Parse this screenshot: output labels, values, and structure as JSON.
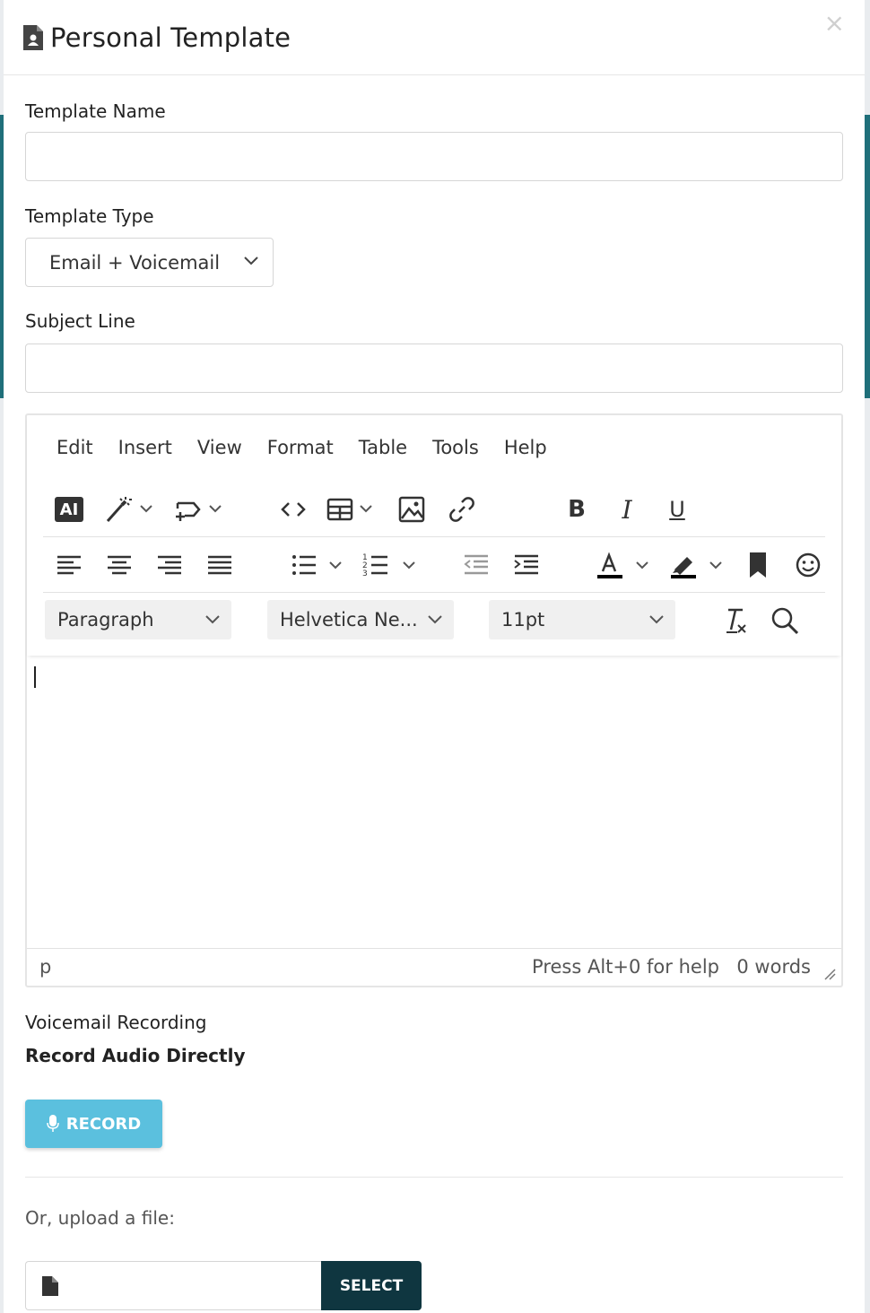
{
  "modal": {
    "title": "Personal Template",
    "close_label": "×"
  },
  "form": {
    "template_name_label": "Template Name",
    "template_name_value": "",
    "template_type_label": "Template Type",
    "template_type_value": "Email + Voicemail",
    "subject_label": "Subject Line",
    "subject_value": ""
  },
  "editor": {
    "menu": [
      "Edit",
      "Insert",
      "View",
      "Format",
      "Table",
      "Tools",
      "Help"
    ],
    "ai_label": "AI",
    "block_format": "Paragraph",
    "font_family": "Helvetica Ne...",
    "font_size": "11pt",
    "status_path": "p",
    "status_help": "Press Alt+0 for help",
    "word_count": "0 words",
    "icons": {
      "row1": [
        "ai-icon",
        "magic-wand-icon",
        "template-insert-icon",
        "code-icon",
        "table-icon",
        "image-icon",
        "link-icon",
        "bold-icon",
        "italic-icon",
        "underline-icon"
      ],
      "row2": [
        "align-left-icon",
        "align-center-icon",
        "align-right-icon",
        "align-justify-icon",
        "bullet-list-icon",
        "numbered-list-icon",
        "outdent-icon",
        "indent-icon",
        "text-color-icon",
        "highlight-icon",
        "bookmark-icon",
        "emoji-icon"
      ],
      "row3": [
        "clear-format-icon",
        "search-icon"
      ]
    }
  },
  "voicemail": {
    "label": "Voicemail Recording",
    "sub_label": "Record Audio Directly",
    "record_label": "RECORD",
    "upload_label": "Or, upload a file:",
    "select_label": "SELECT"
  },
  "colors": {
    "record_button": "#5bc0de",
    "select_button": "#0f3640"
  }
}
